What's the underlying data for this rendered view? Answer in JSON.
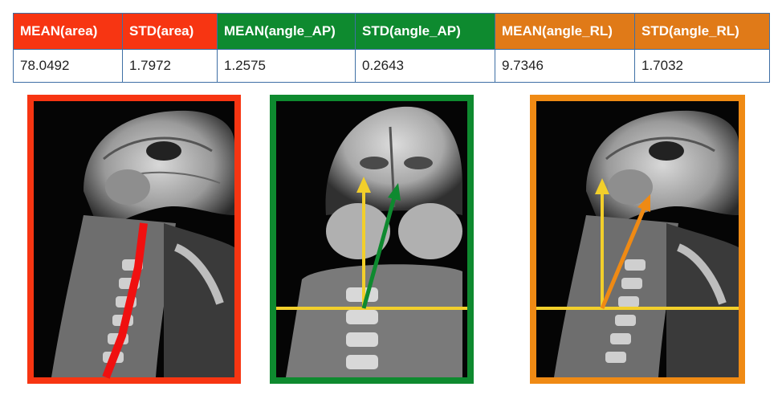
{
  "colors": {
    "area": "#f73512",
    "angle_ap": "#0e8a2f",
    "angle_rl": "#ef8a14",
    "reference_line": "#f2cf2b",
    "table_border": "#3e6fa5"
  },
  "metrics_table": {
    "headers": [
      "MEAN(area)",
      "STD(area)",
      "MEAN(angle_AP)",
      "STD(angle_AP)",
      "MEAN(angle_RL)",
      "STD(angle_RL)"
    ],
    "values": [
      "78.0492",
      "1.7972",
      "1.2575",
      "0.2643",
      "9.7346",
      "1.7032"
    ]
  },
  "images": [
    {
      "name": "sagittal-mri-area",
      "frame_color": "red",
      "overlay": "red spinal cord segmentation line"
    },
    {
      "name": "coronal-mri-angle-ap",
      "frame_color": "green",
      "overlay": "yellow vertical reference and green cord axis arrows with horizontal baseline"
    },
    {
      "name": "sagittal-mri-angle-rl",
      "frame_color": "orange",
      "overlay": "yellow vertical reference and orange cord axis arrows with horizontal baseline"
    }
  ]
}
